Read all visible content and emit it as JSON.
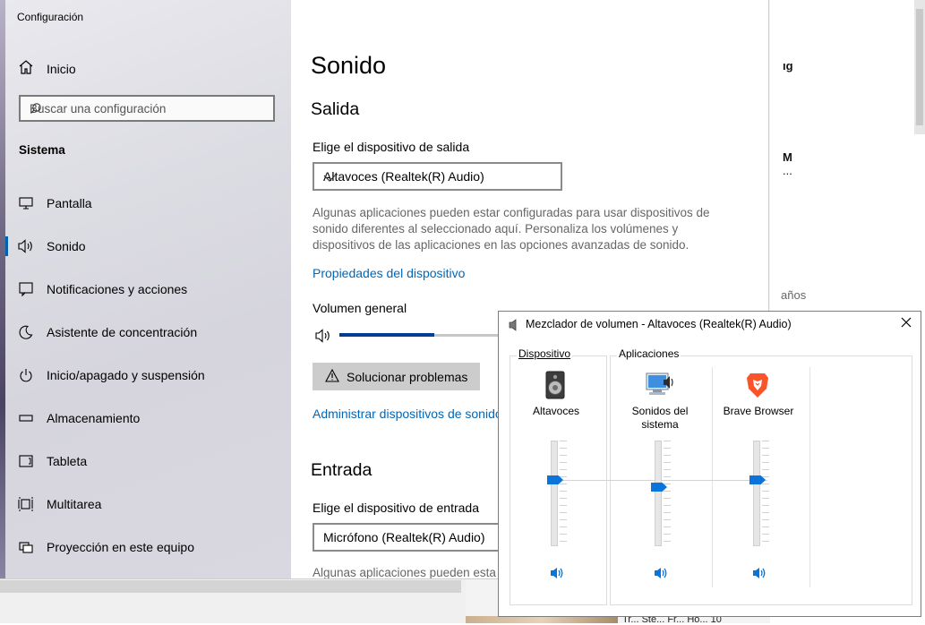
{
  "background": {
    "right_texts": [
      "ıg",
      "M",
      "...",
      "años"
    ],
    "caption": "Tr... Ste... Fr... Ho... 10"
  },
  "settings": {
    "window_title": "Configuración",
    "nav": {
      "home": "Inicio",
      "search_placeholder": "Buscar una configuración",
      "section": "Sistema",
      "items": [
        {
          "label": "Pantalla",
          "icon": "monitor-icon"
        },
        {
          "label": "Sonido",
          "icon": "speaker-icon",
          "selected": true
        },
        {
          "label": "Notificaciones y acciones",
          "icon": "notification-icon"
        },
        {
          "label": "Asistente de concentración",
          "icon": "moon-icon"
        },
        {
          "label": "Inicio/apagado y suspensión",
          "icon": "power-icon"
        },
        {
          "label": "Almacenamiento",
          "icon": "storage-icon"
        },
        {
          "label": "Tableta",
          "icon": "tablet-icon"
        },
        {
          "label": "Multitarea",
          "icon": "multitask-icon"
        },
        {
          "label": "Proyección en este equipo",
          "icon": "projection-icon"
        }
      ]
    },
    "main": {
      "title": "Sonido",
      "output_heading": "Salida",
      "output_label": "Elige el dispositivo de salida",
      "output_device": "Altavoces (Realtek(R) Audio)",
      "output_description": "Algunas aplicaciones pueden estar configuradas para usar dispositivos de sonido diferentes al seleccionado aquí. Personaliza los volúmenes y dispositivos de las aplicaciones en las opciones avanzadas de sonido.",
      "device_properties_link": "Propiedades del dispositivo",
      "master_volume_label": "Volumen general",
      "master_volume_level": 0.59,
      "troubleshoot_button": "Solucionar problemas",
      "manage_devices_link": "Administrar dispositivos de sonido",
      "input_heading": "Entrada",
      "input_label": "Elige el dispositivo de entrada",
      "input_device": "Micrófono (Realtek(R) Audio)",
      "input_description": "Algunas aplicaciones pueden esta"
    }
  },
  "mixer": {
    "title": "Mezclador de volumen - Altavoces (Realtek(R) Audio)",
    "device_group": "Dispositivo",
    "apps_group": "Aplicaciones",
    "channels": [
      {
        "name": "Altavoces",
        "icon": "speaker-device-icon",
        "level": 0.62
      },
      {
        "name": "Sonidos del sistema",
        "icon": "system-sounds-icon",
        "level": 0.55
      },
      {
        "name": "Brave Browser",
        "icon": "brave-lion-icon",
        "level": 0.62
      }
    ],
    "colors": {
      "accent": "#0a74da",
      "brave": "#fb542b"
    }
  }
}
